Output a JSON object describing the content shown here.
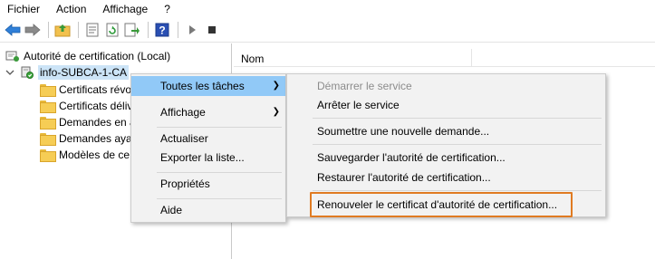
{
  "menubar": {
    "items": [
      "Fichier",
      "Action",
      "Affichage",
      "?"
    ]
  },
  "toolbar": {
    "icons": [
      "back-arrow-icon",
      "forward-arrow-icon",
      "up-folder-icon",
      "properties-icon",
      "refresh-icon",
      "export-list-icon",
      "help-icon",
      "play-icon",
      "stop-icon"
    ]
  },
  "tree": {
    "root": "Autorité de certification (Local)",
    "ca": "info-SUBCA-1-CA",
    "children": [
      "Certificats révo",
      "Certificats déliv",
      "Demandes en a",
      "Demandes aya",
      "Modèles de ce"
    ]
  },
  "list": {
    "column": "Nom"
  },
  "context_menu": {
    "items": [
      "Toutes les tâches",
      "Affichage",
      "Actualiser",
      "Exporter la liste...",
      "Propriétés",
      "Aide"
    ]
  },
  "submenu": {
    "items": [
      "Démarrer le service",
      "Arrêter le service",
      "Soumettre une nouvelle demande...",
      "Sauvegarder l'autorité de certification...",
      "Restaurer l'autorité de certification...",
      "Renouveler le certificat d'autorité de certification..."
    ]
  },
  "colors": {
    "highlight": "#91c9f7",
    "callout": "#e07b22",
    "menu_bg": "#f2f2f2"
  }
}
